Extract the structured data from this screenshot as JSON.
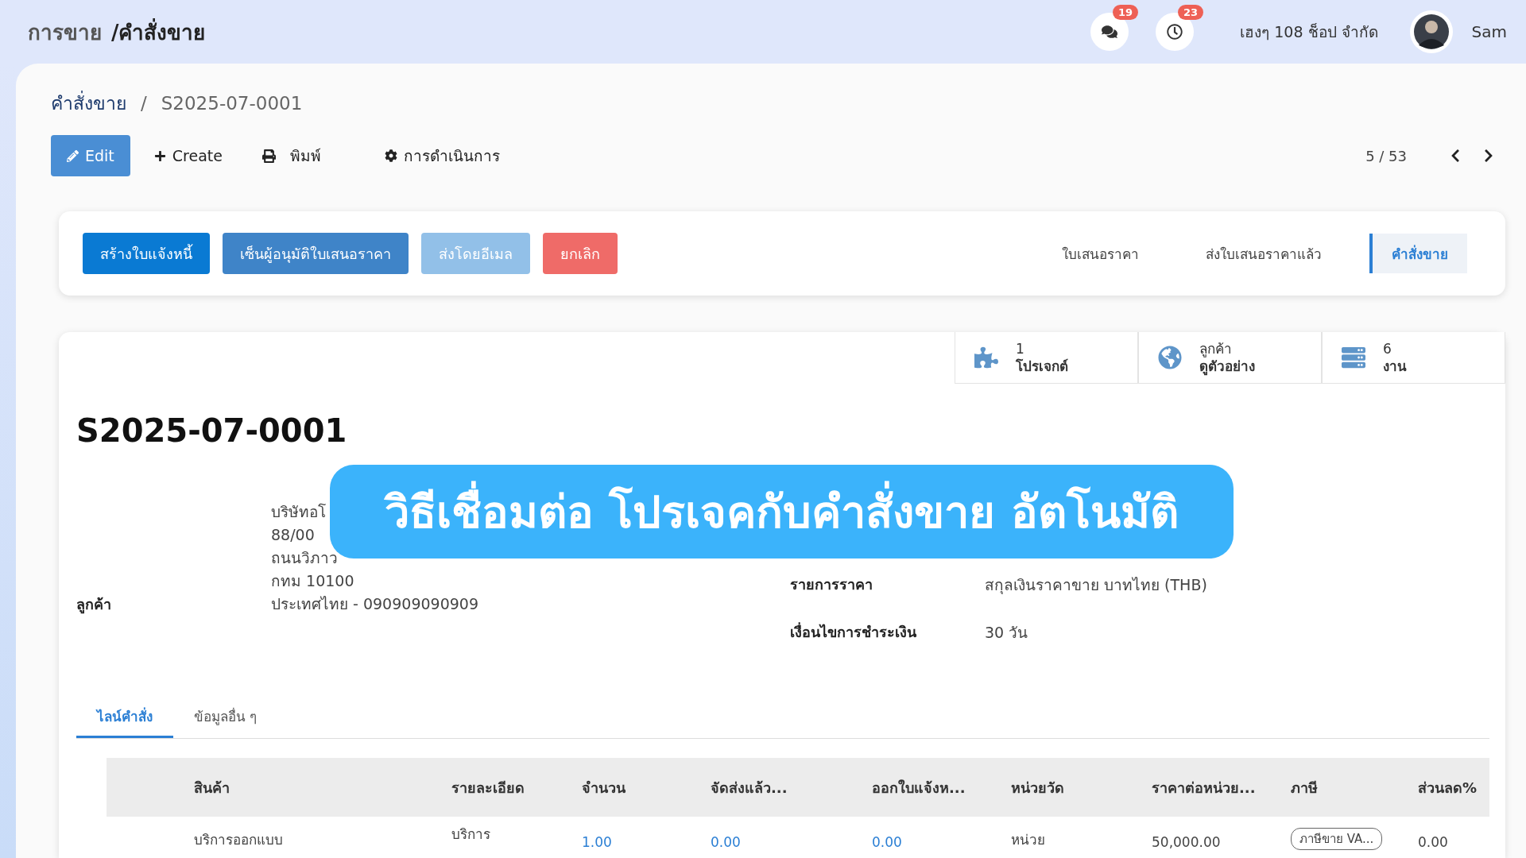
{
  "header": {
    "breadcrumb": [
      "การขาย",
      "/คำสั่งขาย"
    ],
    "notifications": [
      {
        "kind": "chat",
        "count": "19"
      },
      {
        "kind": "activity",
        "count": "23"
      }
    ],
    "company": "เฮงๆ 108 ช็อป จำกัด",
    "user": "Sam"
  },
  "breadcrumb": [
    "คำสั่งขาย",
    "/",
    "S2025-07-0001"
  ],
  "toolbar": [
    {
      "kind": "edit",
      "label": "Edit"
    },
    {
      "kind": "create",
      "label": "Create"
    },
    {
      "kind": "print",
      "label": "พิมพ์"
    },
    {
      "kind": "action",
      "label": "การดำเนินการ"
    }
  ],
  "pager": "5 / 53",
  "actions": [
    {
      "kind": "primary",
      "label": "สร้างใบแจ้งหนี้"
    },
    {
      "kind": "secondary",
      "label": "เซ็นผู้อนุมัติใบเสนอราคา"
    },
    {
      "kind": "muted",
      "label": "ส่งโดยอีเมล"
    },
    {
      "kind": "danger",
      "label": "ยกเลิก"
    }
  ],
  "stages": [
    {
      "label": "ใบเสนอราคา",
      "selected": false
    },
    {
      "label": "ส่งใบเสนอราคาแล้ว",
      "selected": false
    },
    {
      "label": "คำสั่งขาย",
      "selected": true
    }
  ],
  "smart_buttons": [
    {
      "kind": "puzzle",
      "value": "1",
      "label": "โปรเจกต์"
    },
    {
      "kind": "globe",
      "value": "ลูกค้า",
      "label": "ดูตัวอย่าง"
    },
    {
      "kind": "tasks",
      "value": "6",
      "label": "งาน"
    }
  ],
  "title": "S2025-07-0001",
  "customer": {
    "label": "ลูกค้า",
    "lines": [
      "บริษัทอโ",
      "88/00",
      "ถนนวิภาว",
      "กทม 10100",
      "ประเทศไทย - 090909090909"
    ]
  },
  "fields": [
    {
      "label": "รายการราคา",
      "value": "สกุลเงินราคาขาย บาทไทย (THB)"
    },
    {
      "label": "เงื่อนไขการชำระเงิน",
      "value": "30 วัน"
    }
  ],
  "banner": "วิธีเชื่อมต่อ โปรเจคกับคำสั่งขาย อัตโนมัติ",
  "tabs": [
    {
      "label": "ไลน์คำสั่ง",
      "selected": true
    },
    {
      "label": "ข้อมูลอื่น ๆ",
      "selected": false
    }
  ],
  "table": {
    "columns": [
      "สินค้า",
      "รายละเอียด",
      "จำนวน",
      "จัดส่งแล้ว...",
      "ออกใบแจ้งห...",
      "หน่วยวัด",
      "ราคาต่อหน่วย...",
      "ภาษี",
      "ส่วนลด%"
    ],
    "rows": [
      {
        "cells": [
          {
            "kind": "text",
            "text": "บริการออกแบบ"
          },
          {
            "kind": "upper",
            "text": "บริการ"
          },
          {
            "kind": "link",
            "text": "1.00"
          },
          {
            "kind": "link",
            "text": "0.00"
          },
          {
            "kind": "link",
            "text": "0.00"
          },
          {
            "kind": "text",
            "text": "หน่วย"
          },
          {
            "kind": "text",
            "text": "50,000.00"
          },
          {
            "kind": "tag",
            "text": "ภาษีขาย VA..."
          },
          {
            "kind": "text",
            "text": "0.00"
          }
        ]
      }
    ]
  }
}
